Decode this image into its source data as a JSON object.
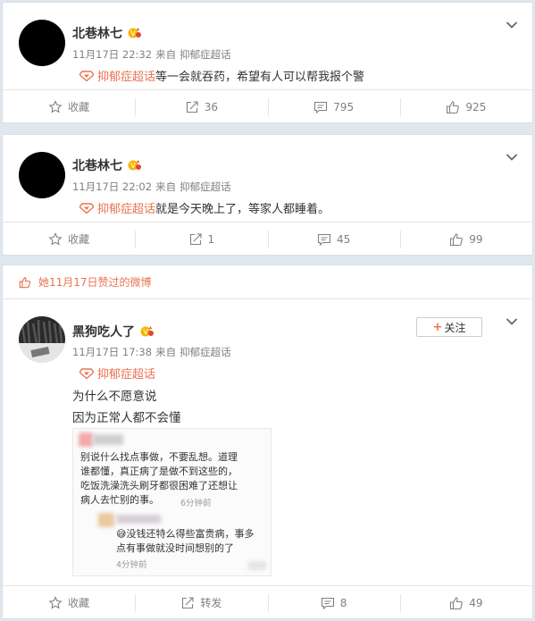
{
  "colors": {
    "accent": "#eb7350",
    "muted": "#808080",
    "border": "#e6e6e6"
  },
  "posts": [
    {
      "username": "北巷林七",
      "date": "11月17日 22:32",
      "from": "来自",
      "source": "抑郁症超话",
      "topic": "抑郁症超话",
      "text": "等一会就吞药，希望有人可以帮我报个警",
      "actions": {
        "favorite": "收藏",
        "share": "36",
        "comment": "795",
        "like": "925"
      }
    },
    {
      "username": "北巷林七",
      "date": "11月17日 22:02",
      "from": "来自",
      "source": "抑郁症超话",
      "topic": "抑郁症超话",
      "text": "就是今天晚上了，等家人都睡着。",
      "actions": {
        "favorite": "收藏",
        "share": "1",
        "comment": "45",
        "like": "99"
      }
    },
    {
      "liked_notice": "她11月17日赞过的微博",
      "username": "黑狗吃人了",
      "follow_label": "关注",
      "date": "11月17日 17:38",
      "from": "来自",
      "source": "抑郁症超话",
      "topic": "抑郁症超话",
      "lines": [
        "为什么不愿意说",
        "因为正常人都不会懂"
      ],
      "screenshot": {
        "lines1": [
          "别说什么找点事做，不要乱想。道理",
          "谁都懂，真正病了是做不到这些的，",
          "吃饭洗澡洗头刷牙都很困难了还想让",
          "病人去忙别的事。"
        ],
        "time1": "6分钟前",
        "lines2": [
          "😅没钱还特么得些富贵病，事多",
          "点有事做就没时间想别的了"
        ],
        "time2": "4分钟前"
      },
      "actions": {
        "favorite": "收藏",
        "share": "转发",
        "comment": "8",
        "like": "49"
      }
    }
  ]
}
